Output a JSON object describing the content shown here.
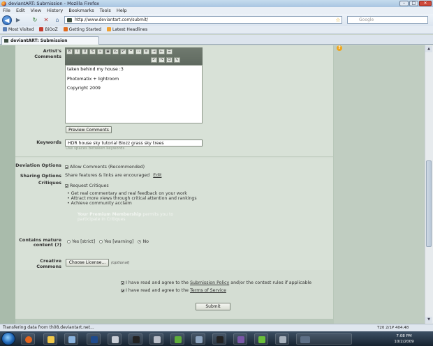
{
  "window": {
    "title": "deviantART: Submission - Mozilla Firefox",
    "minimize": "–",
    "maximize": "□",
    "close": "✕"
  },
  "menu": [
    "File",
    "Edit",
    "View",
    "History",
    "Bookmarks",
    "Tools",
    "Help"
  ],
  "nav": {
    "url": "http://www.deviantart.com/submit/",
    "search_placeholder": "Google"
  },
  "bookmarks": [
    {
      "label": "Most Visited",
      "color": "#5b7fb5"
    },
    {
      "label": "BiOoZ",
      "color": "#c43a2e"
    },
    {
      "label": "Getting Started",
      "color": "#e06b1f"
    },
    {
      "label": "Latest Headlines",
      "color": "#f0a030"
    }
  ],
  "tab": {
    "title": "deviantART: Submission"
  },
  "form": {
    "artists_comments_label": "Artist's Comments",
    "comments_lines": [
      "taken behind my house :3",
      "Photomatix + lightroom",
      "Copyright 2009"
    ],
    "preview_button": "Preview Comments",
    "keywords_label": "Keywords",
    "keywords_value": "HDR house sky tutorial Biozz grass sky trees",
    "keywords_hint": "Use spaces between keywords",
    "deviation_options_label": "Deviation Options",
    "allow_comments": "Allow Comments (Recommended)",
    "sharing_options_label": "Sharing Options",
    "sharing_text": "Share features & links are encouraged",
    "sharing_edit": "Edit",
    "critiques_label": "Critiques",
    "request_critiques": "Request Critiques",
    "critique_bullets": [
      "Get real commentary and real feedback on your work",
      "Attract more views through critical attention and rankings",
      "Achieve community acclaim"
    ],
    "premium_bold": "Your Premium Membership",
    "premium_rest_1": " permits you to",
    "premium_rest_2": "participate in Critiques",
    "mature_label_1": "Contains mature",
    "mature_label_2": "content (?)",
    "mature_options": [
      "Yes [strict]",
      "Yes [warning]",
      "No"
    ],
    "mature_selected": "No",
    "creative_commons_label": "Creative Commons",
    "choose_license_button": "Choose License...",
    "optional": "(optional)",
    "agree1_pre": "I have read and agree to the ",
    "agree1_link": "Submission Policy",
    "agree1_post": " and/or the contest rules if applicable",
    "agree2_pre": "I have read and agree to the ",
    "agree2_link": "Terms of Service",
    "submit_button": "Submit"
  },
  "toolbar_icons": [
    "bold-icon",
    "italic-icon",
    "underline-icon",
    "strike-icon",
    "link-icon",
    "image-icon",
    "subscript-icon",
    "superscript-icon",
    "quote-icon",
    "code-icon",
    "list-icon",
    "indent-icon",
    "outdent-icon",
    "align-icon"
  ],
  "toolbar_glyphs": [
    "B",
    "I",
    "U",
    "S",
    "∞",
    "▣",
    "x₂",
    "x²",
    "❝",
    "‹›",
    "≡",
    "⇥",
    "⇤",
    "☰",
    "↶",
    "↷",
    "☺",
    "✎"
  ],
  "status": {
    "text": "Transfering data from th08.deviantart.net...",
    "tray_line": "T20 2/1P 404.48"
  },
  "taskbar": {
    "clock_time": "7:08 PM",
    "clock_date": "10/2/2009"
  },
  "colors": {
    "panel": "#d8e1d7",
    "background": "#b8c7b9",
    "toolbar": "#66705f"
  }
}
